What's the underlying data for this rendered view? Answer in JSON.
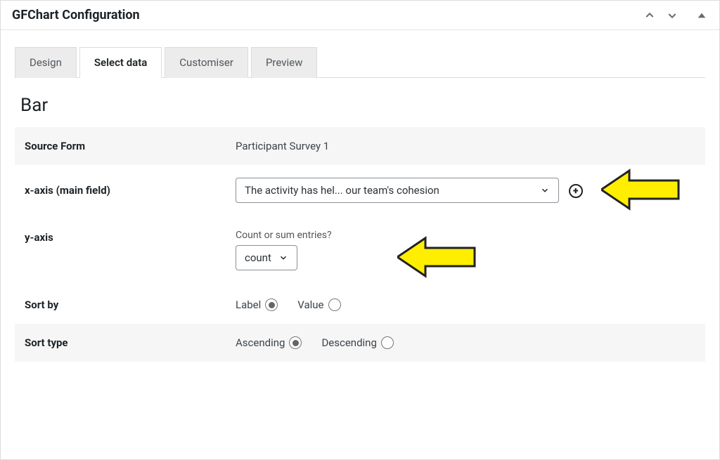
{
  "header": {
    "title": "GFChart Configuration"
  },
  "tabs": [
    {
      "label": "Design",
      "active": false
    },
    {
      "label": "Select data",
      "active": true
    },
    {
      "label": "Customiser",
      "active": false
    },
    {
      "label": "Preview",
      "active": false
    }
  ],
  "section_heading": "Bar",
  "rows": {
    "source_form": {
      "label": "Source Form",
      "value": "Participant Survey 1"
    },
    "x_axis": {
      "label": "x-axis (main field)",
      "selected": "The activity has hel... our team's cohesion"
    },
    "y_axis": {
      "label": "y-axis",
      "sublabel": "Count or sum entries?",
      "selected": "count"
    },
    "sort_by": {
      "label": "Sort by",
      "options": {
        "label": "Label",
        "value": "Value"
      },
      "selected": "Label"
    },
    "sort_type": {
      "label": "Sort type",
      "options": {
        "asc": "Ascending",
        "desc": "Descending"
      },
      "selected": "Ascending"
    }
  }
}
